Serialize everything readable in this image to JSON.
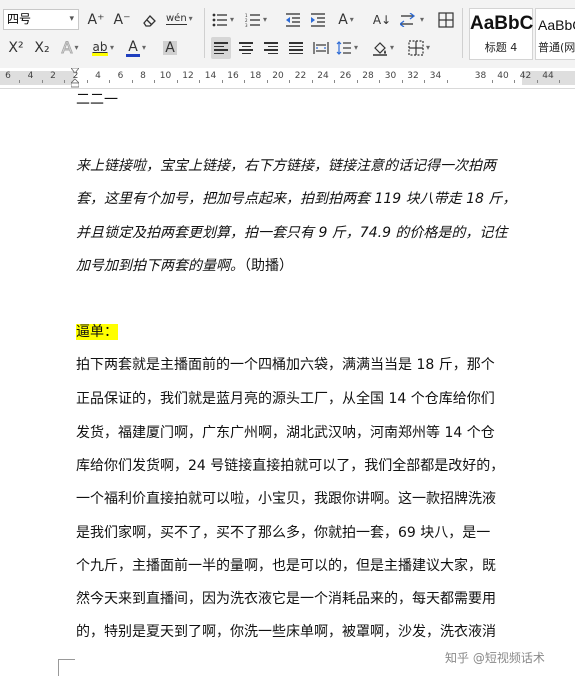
{
  "ribbon": {
    "font_size_value": "四号",
    "grow_font_label": "A⁺",
    "shrink_font_label": "A⁻",
    "phonetic_label": "wén",
    "superscript_label": "X²",
    "subscript_label": "X₂",
    "text_effect_label": "A",
    "highlight_label": "ab",
    "font_color_label": "A",
    "char_shading_label": "A",
    "chinese_layout_label": "A",
    "sort_label": "A↓",
    "font_color_hex": "#1f3fbf",
    "highlight_hex": "#ffff00",
    "styles": [
      {
        "sample": "AaBbC",
        "name": "标题 4"
      },
      {
        "sample": "AaBbC",
        "name": "普通(网"
      }
    ]
  },
  "ruler": {
    "numbers": [
      "6",
      "4",
      "2",
      "2",
      "4",
      "6",
      "8",
      "10",
      "12",
      "14",
      "16",
      "18",
      "20",
      "22",
      "24",
      "26",
      "28",
      "30",
      "32",
      "34",
      "38",
      "40",
      "42",
      "44"
    ]
  },
  "document": {
    "top_line": "二二一",
    "italic_lines": [
      "来上链接啦，宝宝上链接，右下方链接，链接注意的话记得一次拍两",
      "套，这里有个加号，把加号点起来，拍到拍两套 119 块八带走 18 斤，",
      "并且锁定及拍两套更划算，拍一套只有 9 斤，74.9 的价格是的，记住",
      "加号加到拍下两套的量啊。"
    ],
    "italic_suffix": "（助播）",
    "heading": "逼单：",
    "body_lines": [
      "拍下两套就是主播面前的一个四桶加六袋，满满当当是 18 斤，那个",
      "正品保证的，我们就是蓝月亮的源头工厂，从全国 14 个仓库给你们",
      "发货，福建厦门啊，广东广州啊，湖北武汉呐，河南郑州等 14 个仓",
      "库给你们发货啊，24 号链接直接拍就可以了，我们全部都是改好的，",
      "一个福利价直接拍就可以啦，小宝贝，我跟你讲啊。这一款招牌洗液",
      "是我们家啊，买不了，买不了那么多，你就拍一套，69 块八，是一",
      "个九斤，主播面前一半的量啊，也是可以的，但是主播建议大家，既",
      "然今天来到直播间，因为洗衣液它是一个消耗品来的，每天都需要用",
      "的，特别是夏天到了啊，你洗一些床单啊，被罩啊，沙发，洗衣液消"
    ],
    "watermark": "知乎 @短视频话术"
  }
}
